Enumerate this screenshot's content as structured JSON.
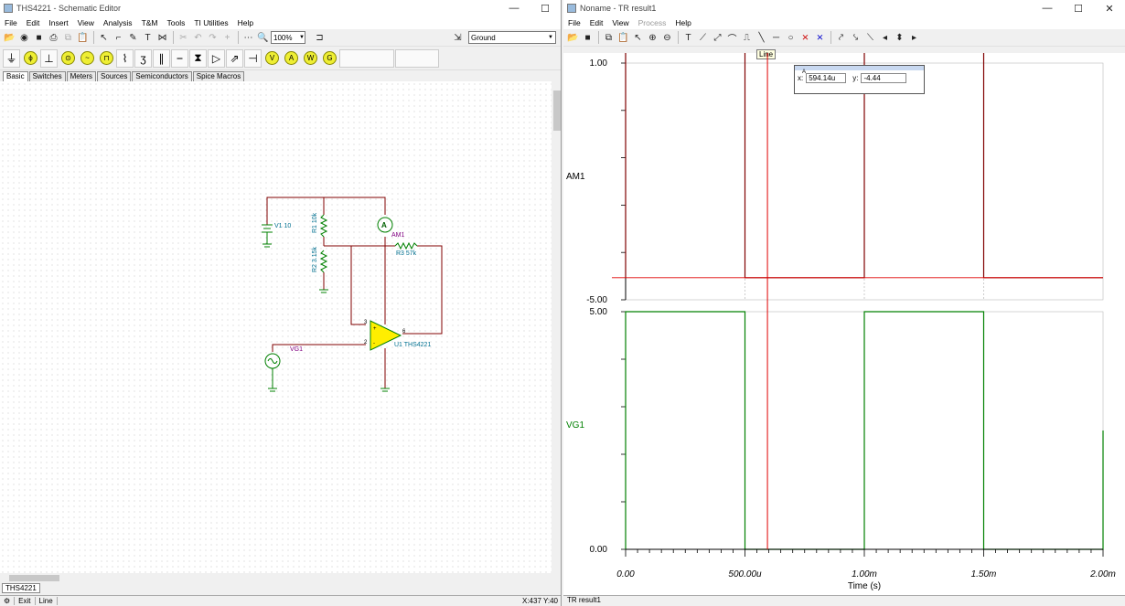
{
  "left": {
    "title": "THS4221 - Schematic Editor",
    "menu": [
      "File",
      "Edit",
      "Insert",
      "View",
      "Analysis",
      "T&M",
      "Tools",
      "TI Utilities",
      "Help"
    ],
    "zoom": "100%",
    "ground_select": "Ground",
    "tabs": [
      "Basic",
      "Switches",
      "Meters",
      "Sources",
      "Semiconductors",
      "Spice Macros"
    ],
    "doc_tab": "THS4221",
    "status": {
      "exit": "Exit",
      "mode": "Line",
      "coords": "X:437  Y:40"
    },
    "components": {
      "v1": "V1 10",
      "r1": "R1 10k",
      "r2": "R2 3.15k",
      "r3": "R3 57k",
      "am1": "AM1",
      "u1": "U1 THS4221",
      "vg1": "VG1",
      "ammeter_glyph": "A",
      "pin3": "3",
      "pin2": "2",
      "pin6": "6",
      "plus": "+",
      "minus": "-"
    }
  },
  "right": {
    "title": "Noname - TR result1",
    "menu": [
      "File",
      "Edit",
      "View",
      "Process",
      "Help"
    ],
    "tooltip": "Line",
    "cursor": {
      "label": "A",
      "x_label": "x:",
      "x": "594.14u",
      "y_label": "y:",
      "y": "-4.44"
    },
    "doc_tab": "TR result1",
    "am1_label": "AM1",
    "vg1_label": "VG1",
    "xlabel": "Time (s)",
    "colors": {
      "am1": "#800000",
      "vg1": "#008000",
      "cursor": "#e00000"
    }
  },
  "chart_data": [
    {
      "type": "line",
      "series": [
        {
          "name": "AM1",
          "x": [
            0,
            0,
            0.0005,
            0.0005,
            0.001,
            0.001,
            0.0015,
            0.0015,
            0.002
          ],
          "y": [
            -4.44,
            4.8,
            4.8,
            -4.44,
            -4.44,
            4.8,
            4.8,
            -4.44,
            -4.44
          ]
        }
      ],
      "ylim": [
        -5,
        1
      ],
      "y_ticks": [
        "1.00",
        "-5.00"
      ],
      "xlim": [
        0,
        0.002
      ]
    },
    {
      "type": "line",
      "series": [
        {
          "name": "VG1",
          "x": [
            0,
            0,
            0.0005,
            0.0005,
            0.001,
            0.001,
            0.0015,
            0.0015,
            0.002,
            0.002
          ],
          "y": [
            0,
            5,
            5,
            0,
            0,
            5,
            5,
            0,
            0,
            2.5
          ]
        }
      ],
      "ylim": [
        0,
        5
      ],
      "y_ticks": [
        "5.00",
        "0.00"
      ],
      "x_ticks": [
        "0.00",
        "500.00u",
        "1.00m",
        "1.50m",
        "2.00m"
      ],
      "xlabel": "Time (s)",
      "xlim": [
        0,
        0.002
      ]
    }
  ]
}
